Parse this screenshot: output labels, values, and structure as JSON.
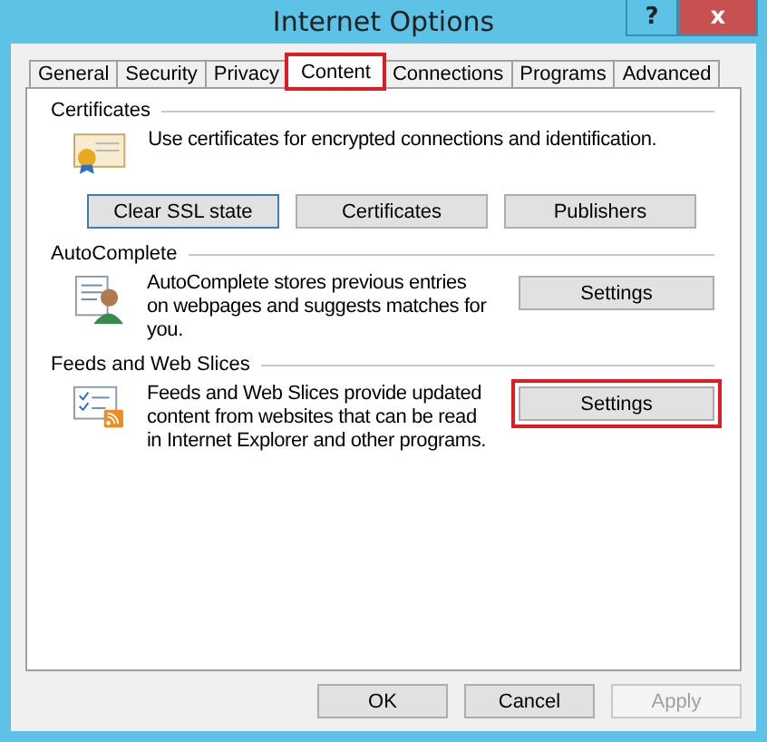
{
  "window": {
    "title": "Internet Options",
    "help": "?",
    "close": "x"
  },
  "tabs": [
    {
      "label": "General",
      "selected": false,
      "highlighted": false
    },
    {
      "label": "Security",
      "selected": false,
      "highlighted": false
    },
    {
      "label": "Privacy",
      "selected": false,
      "highlighted": false
    },
    {
      "label": "Content",
      "selected": true,
      "highlighted": true
    },
    {
      "label": "Connections",
      "selected": false,
      "highlighted": false
    },
    {
      "label": "Programs",
      "selected": false,
      "highlighted": false
    },
    {
      "label": "Advanced",
      "selected": false,
      "highlighted": false
    }
  ],
  "sections": [
    {
      "title": "Certificates",
      "kind": "certificates",
      "text": "Use certificates for encrypted connections and identification.",
      "buttons": [
        {
          "label": "Clear SSL state",
          "focused": true,
          "highlighted": false
        },
        {
          "label": "Certificates",
          "focused": false,
          "highlighted": false
        },
        {
          "label": "Publishers",
          "focused": false,
          "highlighted": false
        }
      ]
    },
    {
      "title": "AutoComplete",
      "kind": "autocomplete",
      "text": "AutoComplete stores previous entries on webpages and suggests matches for you.",
      "buttons": [
        {
          "label": "Settings",
          "focused": false,
          "highlighted": false
        }
      ]
    },
    {
      "title": "Feeds and Web Slices",
      "kind": "feeds",
      "text": "Feeds and Web Slices provide updated content from websites that can be read in Internet Explorer and other programs.",
      "buttons": [
        {
          "label": "Settings",
          "focused": false,
          "highlighted": true
        }
      ]
    }
  ],
  "footer_buttons": [
    {
      "label": "OK",
      "disabled": false
    },
    {
      "label": "Cancel",
      "disabled": false
    },
    {
      "label": "Apply",
      "disabled": true
    }
  ]
}
